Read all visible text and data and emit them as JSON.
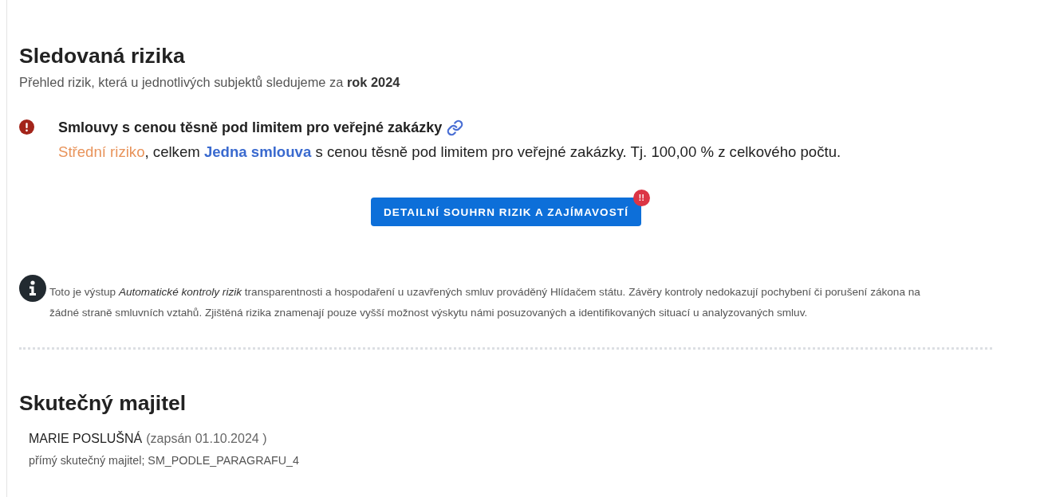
{
  "risks_section": {
    "title": "Sledovaná rizika",
    "subtitle": "Přehled rizik, která u jednotlivých subjektů sledujeme za **rok 2024**"
  },
  "risks": [
    {
      "kind": "alert",
      "title": "Smlouvy s cenou těsně pod limitem pro veřejné zakázky",
      "description": [
        {
          "kind": "level",
          "text": "Střední riziko"
        },
        {
          "kind": "text",
          "text": ", celkem "
        },
        {
          "kind": "link",
          "text": "Jedna smlouva"
        },
        {
          "kind": "text",
          "text": " s cenou těsně pod limitem pro veřejné zakázky. Tj. 100,00 % z celkového počtu."
        }
      ]
    }
  ],
  "summary_button": {
    "label": "DETAILNÍ SOUHRN RIZIK A ZAJÍMAVOSTÍ",
    "badge": "!!"
  },
  "notice": {
    "text": "Toto je výstup *Automatické kontroly rizik* transparentnosti a hospodaření u uzavřených smluv prováděný Hlídačem státu. Závěry kontroly nedokazují pochybení či porušení zákona na žádné straně smluvních vztahů. Zjištěná rizika znamenají pouze vyšší možnost výskytu námi posuzovaných a identifikovaných situací u analyzovaných smluv."
  },
  "owners_section": {
    "title": "Skutečný majitel",
    "owners": [
      {
        "name": "MARIE POSLUŠNÁ",
        "registered": "(zapsán 01.10.2024 )",
        "detail": "přímý skutečný majitel; SM_PODLE_PARAGRAFU_4"
      }
    ]
  }
}
